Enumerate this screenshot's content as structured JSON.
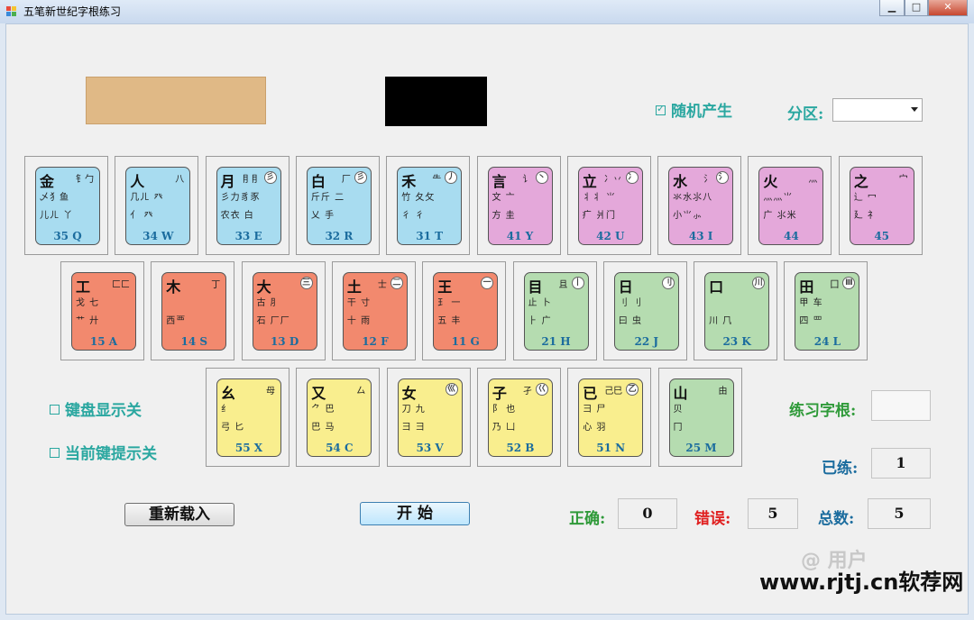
{
  "window": {
    "title": "五笔新世纪字根练习",
    "min_label": "▁",
    "max_label": "□",
    "close_label": "✕"
  },
  "colors": {
    "display_box_1": "#e0b986",
    "display_box_2": "#000000",
    "label_teal": "#2aa7a0",
    "label_green": "#2f9a39",
    "label_red": "#e02020"
  },
  "options": {
    "random_label": "随机产生",
    "random_checked": true,
    "zone_label": "分区:",
    "zone_value": "",
    "keyboard_display_label": "键盘显示关",
    "keyboard_display_checked": false,
    "key_hint_label": "当前键提示关",
    "key_hint_checked": false
  },
  "practice": {
    "root_label": "练习字根:",
    "root_value": "",
    "done_label": "已练:",
    "done_value": "1",
    "correct_label": "正确:",
    "correct_value": "0",
    "wrong_label": "错误:",
    "wrong_value": "5",
    "total_label": "总数:",
    "total_value": "5"
  },
  "buttons": {
    "reload_label": "重新载入",
    "start_label": "开 始"
  },
  "watermark": {
    "text": "www.rjtj.cn软荐网",
    "faded_text": "@ 用户"
  },
  "keyboard": {
    "rows": [
      [
        {
          "main": "金",
          "side": "钅勹",
          "lines": [
            "乄犭鱼",
            "儿ㄦ 丫"
          ],
          "code": "35 Q",
          "zone": "blue",
          "mark": ""
        },
        {
          "main": "人",
          "side": "八",
          "lines": [
            "几ㄦ 癶",
            "亻 癶"
          ],
          "code": "34 W",
          "zone": "blue",
          "mark": ""
        },
        {
          "main": "月",
          "side": "⺝⺝",
          "lines": [
            "彡力豸豕",
            "农衣 白"
          ],
          "code": "33 E",
          "zone": "blue",
          "mark": "彡"
        },
        {
          "main": "白",
          "side": "厂",
          "lines": [
            "斤斤 ⼆",
            "乂 手"
          ],
          "code": "32 R",
          "zone": "blue",
          "mark": "彡"
        },
        {
          "main": "禾",
          "side": "⺧",
          "lines": [
            "竹 夂攵",
            "彳 彳"
          ],
          "code": "31 T",
          "zone": "blue",
          "mark": "丿"
        },
        {
          "main": "言",
          "side": "讠",
          "lines": [
            "文 亠",
            "方 圭"
          ],
          "code": "41 Y",
          "zone": "pink",
          "mark": "丶"
        },
        {
          "main": "立",
          "side": "冫丷",
          "lines": [
            "丬丬 ⺌",
            "疒 爿门"
          ],
          "code": "42 U",
          "zone": "pink",
          "mark": "冫"
        },
        {
          "main": "水",
          "side": "氵",
          "lines": [
            "氺水⺢八",
            "小⺌⺗"
          ],
          "code": "43 I",
          "zone": "pink",
          "mark": "氵"
        },
        {
          "main": "火",
          "side": "灬",
          "lines": [
            "⺣灬⺌",
            "广 ⺢米"
          ],
          "code": "44",
          "zone": "pink",
          "mark": ""
        },
        {
          "main": "之",
          "side": "宀",
          "lines": [
            "辶 冖",
            "廴 礻"
          ],
          "code": "45",
          "zone": "pink",
          "mark": ""
        }
      ],
      [
        {
          "main": "工",
          "side": "⼕匚",
          "lines": [
            "戈 七",
            "艹 廾"
          ],
          "code": "15 A",
          "zone": "red",
          "mark": ""
        },
        {
          "main": "木",
          "side": "丁",
          "lines": [
            "",
            "西覀"
          ],
          "code": "14 S",
          "zone": "red",
          "mark": ""
        },
        {
          "main": "大",
          "side": "",
          "lines": [
            "古 ⺼",
            "石 ⼚厂"
          ],
          "code": "13 D",
          "zone": "red",
          "mark": "三"
        },
        {
          "main": "土",
          "side": "士",
          "lines": [
            "干 寸",
            "十 雨"
          ],
          "code": "12 F",
          "zone": "red",
          "mark": "二"
        },
        {
          "main": "王",
          "side": "",
          "lines": [
            "⺩ 一",
            "五 丰"
          ],
          "code": "11 G",
          "zone": "red",
          "mark": "一"
        },
        {
          "main": "目",
          "side": "且",
          "lines": [
            "止 卜",
            "⺊ 广"
          ],
          "code": "21 H",
          "zone": "green",
          "mark": "丨"
        },
        {
          "main": "日",
          "side": "",
          "lines": [
            "刂 ⺉",
            "曰 虫"
          ],
          "code": "22 J",
          "zone": "green",
          "mark": "刂"
        },
        {
          "main": "口",
          "side": "",
          "lines": [
            "",
            "川 ⺇"
          ],
          "code": "23 K",
          "zone": "green",
          "mark": "川"
        },
        {
          "main": "田",
          "side": "囗",
          "lines": [
            "甲 车",
            "四 罒"
          ],
          "code": "24 L",
          "zone": "green",
          "mark": "Ⅲ"
        }
      ],
      [
        {
          "main": "幺",
          "side": "母",
          "lines": [
            "纟",
            "弓 匕"
          ],
          "code": "55 X",
          "zone": "yellow",
          "mark": ""
        },
        {
          "main": "又",
          "side": "厶",
          "lines": [
            "⺈ 巴",
            "巴 马"
          ],
          "code": "54 C",
          "zone": "yellow",
          "mark": ""
        },
        {
          "main": "女",
          "side": "",
          "lines": [
            "刀 九",
            "彐 ⺕"
          ],
          "code": "53 V",
          "zone": "yellow",
          "mark": "巛"
        },
        {
          "main": "子",
          "side": "孑",
          "lines": [
            "阝 也",
            "乃 凵"
          ],
          "code": "52 B",
          "zone": "yellow",
          "mark": "巜"
        },
        {
          "main": "已",
          "side": "己巳",
          "lines": [
            "⺕ 尸",
            "心 羽"
          ],
          "code": "51 N",
          "zone": "yellow",
          "mark": "乙"
        },
        {
          "main": "山",
          "side": "由",
          "lines": [
            "贝",
            "冂"
          ],
          "code": "25 M",
          "zone": "green",
          "mark": ""
        }
      ]
    ]
  }
}
